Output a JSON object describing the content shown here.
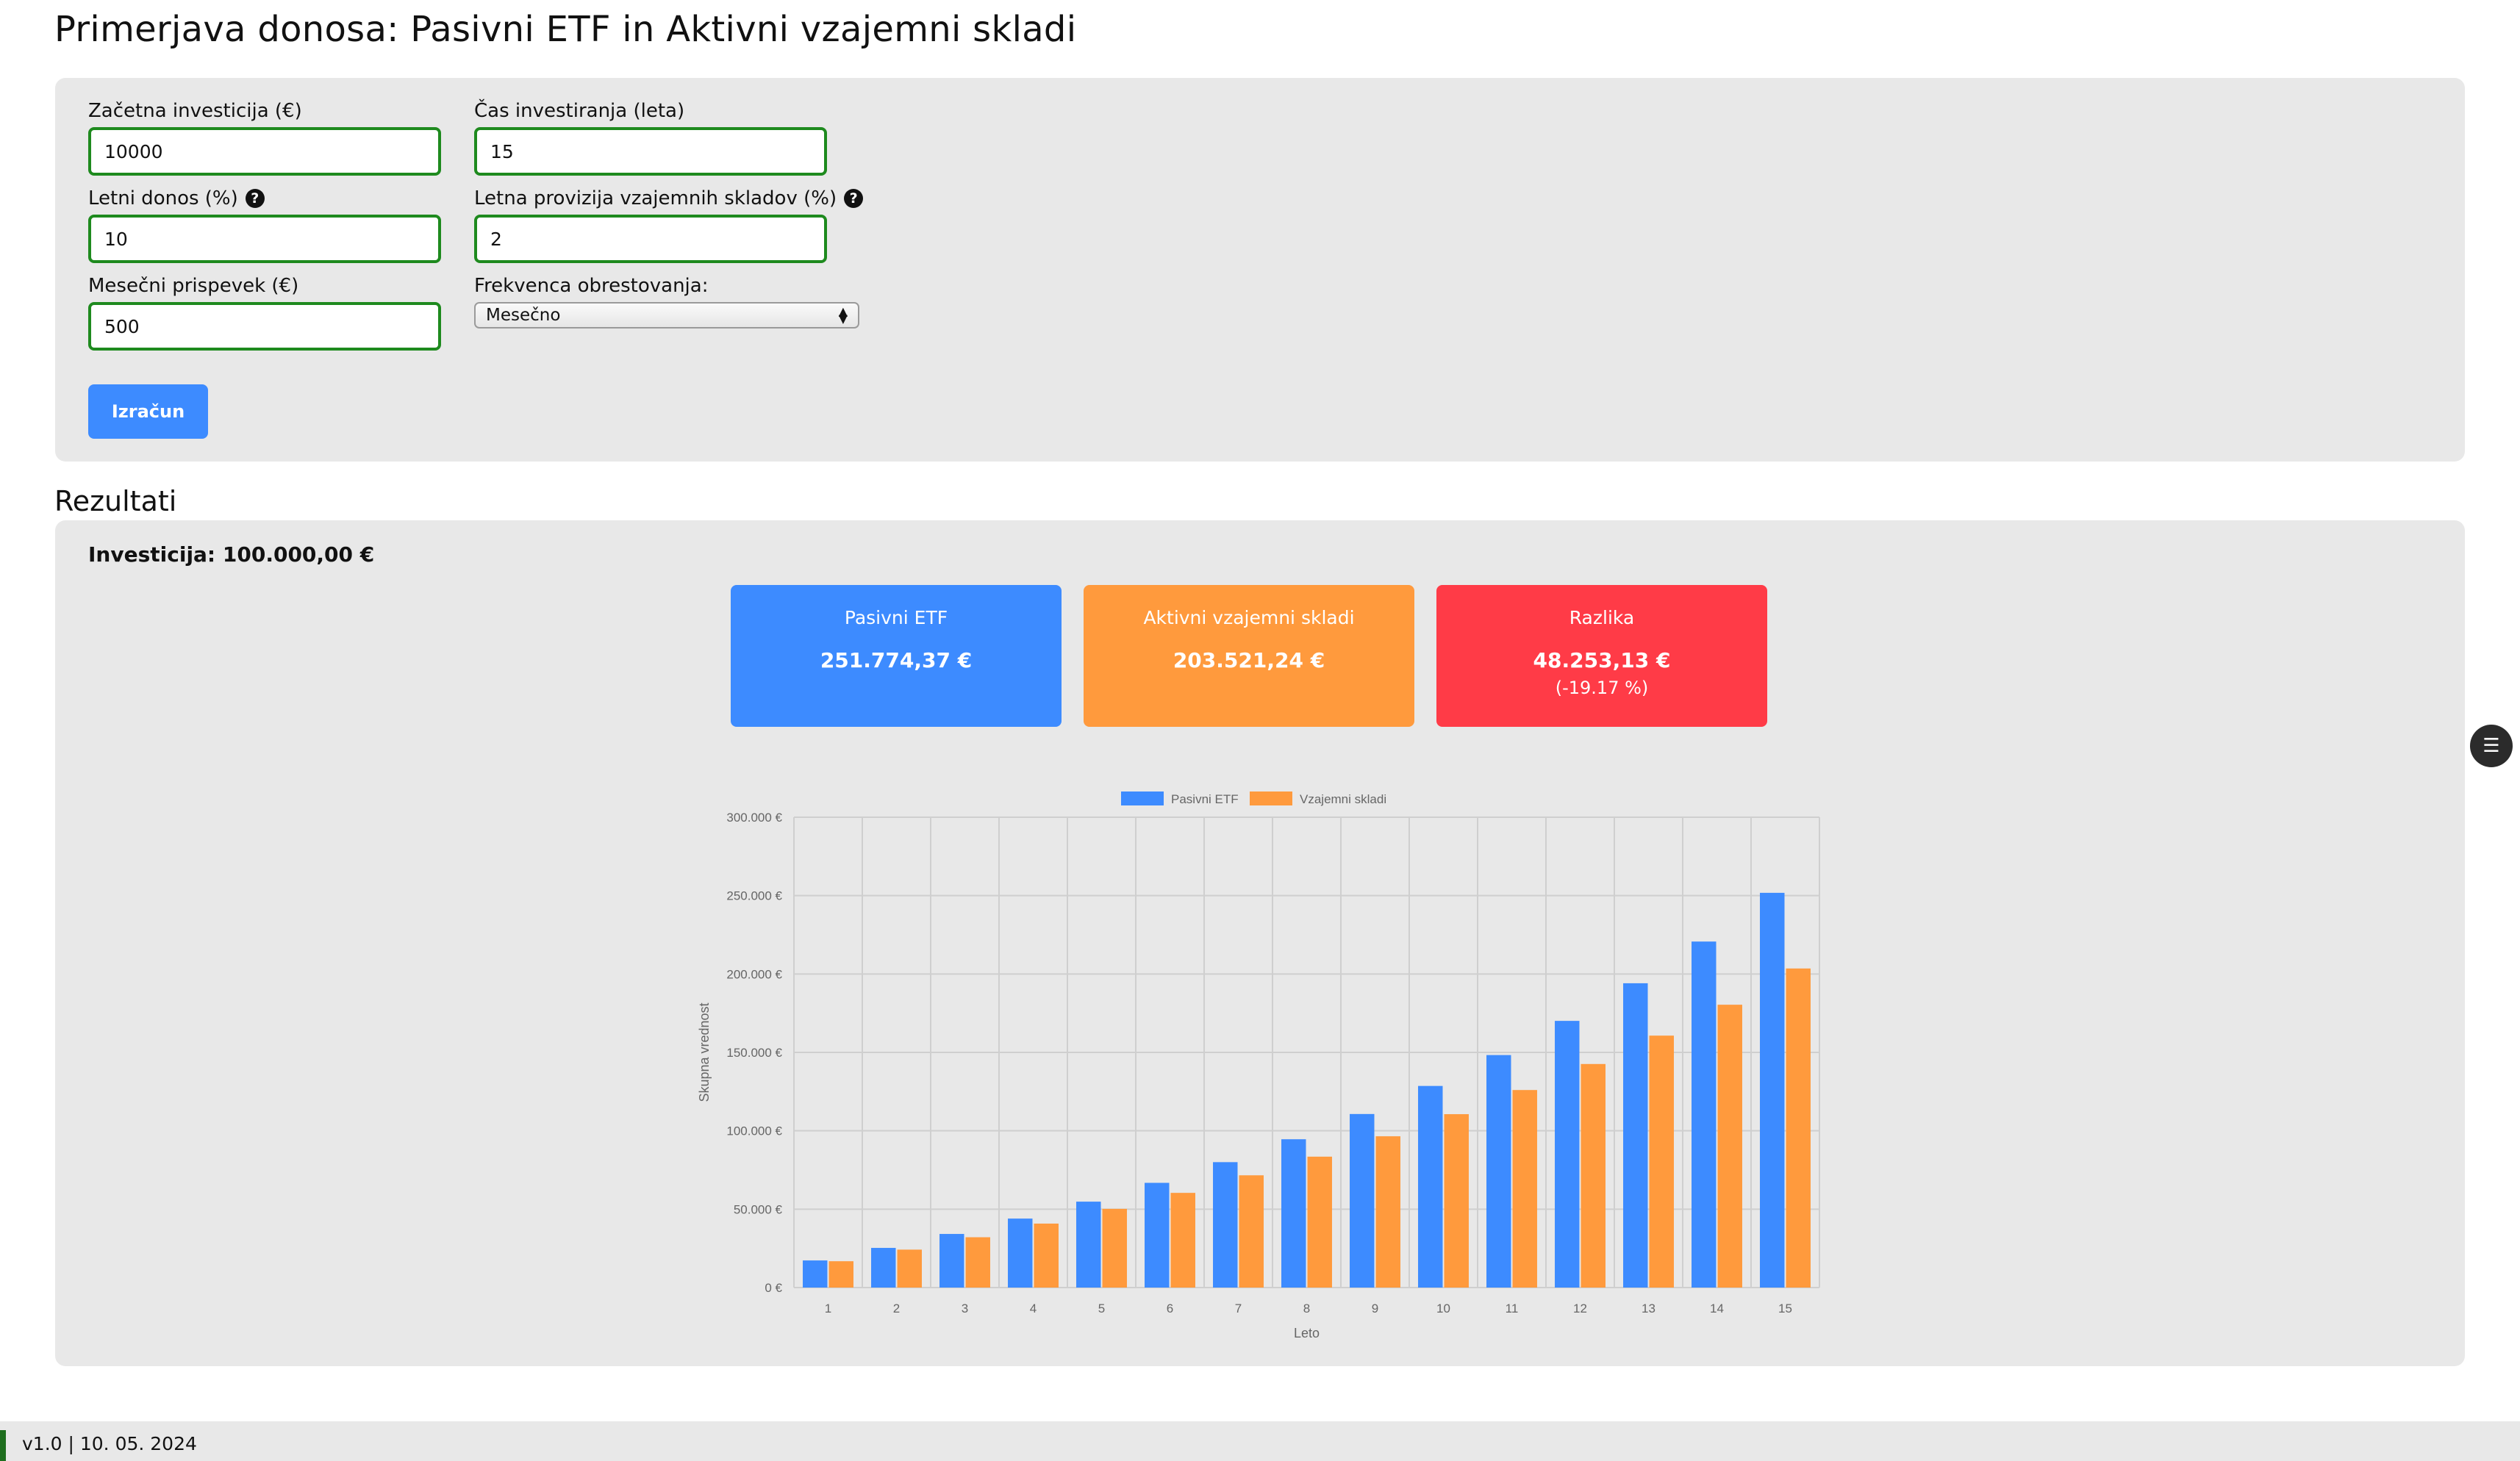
{
  "page": {
    "title": "Primerjava donosa: Pasivni ETF in Aktivni vzajemni skladi"
  },
  "form": {
    "initial_investment": {
      "label": "Začetna investicija (€)",
      "value": "10000"
    },
    "duration": {
      "label": "Čas investiranja (leta)",
      "value": "15"
    },
    "annual_return": {
      "label": "Letni donos (%)",
      "value": "10",
      "help_icon": "question-circle-icon"
    },
    "fund_fee": {
      "label": "Letna provizija vzajemnih skladov (%)",
      "value": "2",
      "help_icon": "question-circle-icon"
    },
    "monthly_contribution": {
      "label": "Mesečni prispevek (€)",
      "value": "500"
    },
    "compounding": {
      "label": "Frekvenca obrestovanja:",
      "selected": "Mesečno"
    },
    "calculate_label": "Izračun"
  },
  "results": {
    "heading": "Rezultati",
    "investment_text": "Investicija: 100.000,00 €",
    "cards": {
      "etf": {
        "title": "Pasivni ETF",
        "value": "251.774,37 €",
        "color": "#3d8bff"
      },
      "funds": {
        "title": "Aktivni vzajemni skladi",
        "value": "203.521,24 €",
        "color": "#ff9a3d"
      },
      "diff": {
        "title": "Razlika",
        "value": "48.253,13 €",
        "sub": "(-19.17 %)",
        "color": "#ff3b47"
      }
    }
  },
  "chart_data": {
    "type": "bar",
    "categories": [
      "1",
      "2",
      "3",
      "4",
      "5",
      "6",
      "7",
      "8",
      "9",
      "10",
      "11",
      "12",
      "13",
      "14",
      "15"
    ],
    "series": [
      {
        "name": "Pasivni ETF",
        "color": "#3d8bff",
        "values": [
          17300,
          25300,
          34200,
          44000,
          54800,
          66800,
          80000,
          94600,
          110700,
          128600,
          148300,
          170100,
          194100,
          220700,
          251774
        ]
      },
      {
        "name": "Vzajemni skladi",
        "color": "#ff9a3d",
        "values": [
          16800,
          24200,
          32100,
          40800,
          50200,
          60400,
          71600,
          83500,
          96500,
          110600,
          126000,
          142600,
          160700,
          180400,
          203521
        ]
      }
    ],
    "xlabel": "Leto",
    "ylabel": "Skupna vrednost",
    "ylim": [
      0,
      300000
    ],
    "yticks": [
      "0 €",
      "50.000 €",
      "100.000 €",
      "150.000 €",
      "200.000 €",
      "250.000 €",
      "300.000 €"
    ],
    "grid": true,
    "legend": "top-center"
  },
  "footer": {
    "text": "v1.0 | 10. 05. 2024"
  },
  "side_button": {
    "icon": "settings-toggle-icon"
  }
}
